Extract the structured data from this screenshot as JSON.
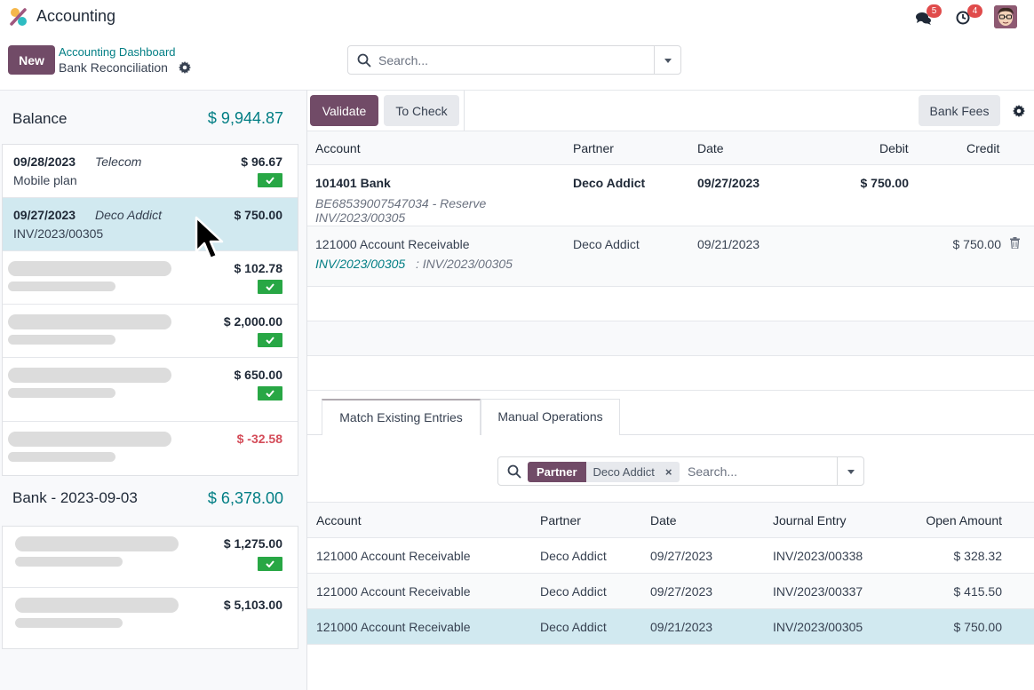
{
  "app": {
    "title": "Accounting",
    "logo_icon": "accounting-logo",
    "colors": {
      "brand": "#714b67",
      "accent": "#017e84",
      "success": "#28a745",
      "danger": "#d44c59",
      "selected_row": "#d1e9f0",
      "badge": "#e04b4b"
    }
  },
  "systray": {
    "messages": {
      "icon": "chat-bubbles-icon",
      "count": "5"
    },
    "activities": {
      "icon": "clock-icon",
      "count": "4"
    },
    "user": {
      "icon": "user-avatar"
    }
  },
  "control_panel": {
    "new_label": "New",
    "breadcrumb_parent": "Accounting Dashboard",
    "breadcrumb_current": "Bank Reconciliation",
    "search_placeholder": "Search..."
  },
  "kanban": {
    "groups": [
      {
        "title": "Balance",
        "amount": "$ 9,944.87",
        "cards": [
          {
            "date": "09/28/2023",
            "partner": "Telecom",
            "ref": "Mobile plan",
            "amount": "$ 96.67",
            "checked": true
          },
          {
            "date": "09/27/2023",
            "partner": "Deco Addict",
            "ref": "INV/2023/00305",
            "amount": "$ 750.00",
            "checked": false,
            "selected": true
          },
          {
            "amount": "$ 102.78",
            "checked": true,
            "placeholder": true
          },
          {
            "amount": "$ 2,000.00",
            "checked": true,
            "placeholder": true
          },
          {
            "amount": "$ 650.00",
            "checked": true,
            "placeholder": true
          },
          {
            "amount": "$ -32.58",
            "checked": false,
            "placeholder": true,
            "negative": true
          }
        ]
      },
      {
        "title": "Bank - 2023-09-03",
        "amount": "$ 6,378.00",
        "cards": [
          {
            "amount": "$ 1,275.00",
            "checked": true,
            "placeholder": true
          },
          {
            "amount": "$ 5,103.00",
            "checked": false,
            "placeholder": true
          }
        ]
      }
    ]
  },
  "toolbar": {
    "validate_label": "Validate",
    "to_check_label": "To Check",
    "bank_fees_label": "Bank Fees"
  },
  "lines_table": {
    "columns": [
      "Account",
      "Partner",
      "Date",
      "Debit",
      "Credit"
    ],
    "rows": [
      {
        "account": "101401 Bank",
        "sub1": "BE68539007547034 - Reserve",
        "sub2": "INV/2023/00305",
        "partner": "Deco Addict",
        "date": "09/27/2023",
        "debit": "$ 750.00",
        "credit": ""
      },
      {
        "account": "121000 Account Receivable",
        "link": "INV/2023/00305",
        "sub_text": ": INV/2023/00305",
        "partner": "Deco Addict",
        "date": "09/21/2023",
        "debit": "",
        "credit": "$ 750.00"
      }
    ]
  },
  "tabs": [
    {
      "label": "Match Existing Entries",
      "active": true
    },
    {
      "label": "Manual Operations",
      "active": false
    }
  ],
  "match_search": {
    "facet_label": "Partner",
    "facet_value": "Deco Addict",
    "facet_remove": "×",
    "placeholder": "Search..."
  },
  "match_table": {
    "columns": [
      "Account",
      "Partner",
      "Date",
      "Journal Entry",
      "Open Amount"
    ],
    "rows": [
      {
        "account": "121000 Account Receivable",
        "partner": "Deco Addict",
        "date": "09/27/2023",
        "entry": "INV/2023/00338",
        "amount": "$ 328.32"
      },
      {
        "account": "121000 Account Receivable",
        "partner": "Deco Addict",
        "date": "09/27/2023",
        "entry": "INV/2023/00337",
        "amount": "$ 415.50"
      },
      {
        "account": "121000 Account Receivable",
        "partner": "Deco Addict",
        "date": "09/21/2023",
        "entry": "INV/2023/00305",
        "amount": "$ 750.00",
        "selected": true
      }
    ]
  }
}
